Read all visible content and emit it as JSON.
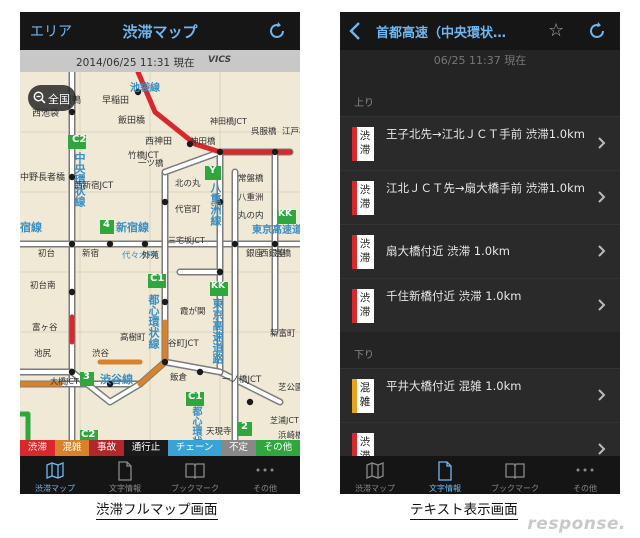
{
  "left_screen": {
    "nav": {
      "left_label": "エリア",
      "title": "渋滞マップ"
    },
    "status_bar": {
      "timestamp": "2014/06/25 11:31 現在",
      "vics": "VICS"
    },
    "zoom_button": {
      "label": "全国"
    },
    "map_labels": [
      "西巣鴨",
      "早稲田",
      "池袋線",
      "飯田橋",
      "西神田",
      "神田橋",
      "神田橋JCT",
      "呉服橋",
      "江戸橋",
      "西池袋",
      "竹橋JCT",
      "一ツ橋",
      "C2",
      "中央環状線",
      "中野長者橋",
      "北の丸",
      "常盤橋",
      "八重洲線",
      "八重洲",
      "丸の内",
      "東京高速道",
      "代官町",
      "西新宿JCT",
      "新宿線",
      "宿線",
      "初台",
      "新宿",
      "代々木PA",
      "外苑",
      "三宅坂JCT",
      "霞が関",
      "銀座",
      "京橋",
      "西銀座",
      "初台南",
      "都心環状線",
      "東京高速道路",
      "富ヶ谷",
      "高樹町",
      "谷町JCT",
      "新富町",
      "池尻",
      "渋谷",
      "渋谷線",
      "大橋JCT",
      "飯倉",
      "一ノ橋JCT",
      "都心環状線",
      "芝公園",
      "天現寺",
      "浜崎橋",
      "芝浦JCT",
      "Y",
      "KK",
      "KK",
      "C1",
      "C1",
      "4",
      "3",
      "C2",
      "2"
    ],
    "legend": [
      {
        "label": "渋滞",
        "color": "#d8282c"
      },
      {
        "label": "混雑",
        "color": "#d9822b"
      },
      {
        "label": "事故",
        "color": "#b0282c"
      },
      {
        "label": "通行止",
        "color": "#1a1a1a"
      },
      {
        "label": "チェーン",
        "color": "#3aa3d6"
      },
      {
        "label": "不定",
        "color": "#888888"
      },
      {
        "label": "その他",
        "color": "#2ea83d"
      }
    ],
    "tabs": [
      {
        "label": "渋滞マップ",
        "icon": "map-icon",
        "active": true
      },
      {
        "label": "文字情報",
        "icon": "document-icon",
        "active": false
      },
      {
        "label": "ブックマーク",
        "icon": "book-icon",
        "active": false
      },
      {
        "label": "その他",
        "icon": "more-icon",
        "active": false
      }
    ]
  },
  "right_screen": {
    "nav": {
      "title": "首都高速（中央環状…"
    },
    "timestamp": "06/25 11:37 現在",
    "sections": [
      {
        "header": "上り",
        "rows": [
          {
            "badge": "渋滞",
            "badge_color": "#d8282c",
            "text": "王子北先→江北ＪＣＴ手前 渋滞1.0km"
          },
          {
            "badge": "渋滞",
            "badge_color": "#d8282c",
            "text": "江北ＪＣＴ先→扇大橋手前 渋滞1.0km"
          },
          {
            "badge": "渋滞",
            "badge_color": "#d8282c",
            "text": "扇大橋付近 渋滞 1.0km"
          },
          {
            "badge": "渋滞",
            "badge_color": "#d8282c",
            "text": "千住新橋付近 渋滞 1.0km"
          }
        ]
      },
      {
        "header": "下り",
        "rows": [
          {
            "badge": "混雑",
            "badge_color": "#e8a21e",
            "text": "平井大橋付近 混雑 1.0km"
          },
          {
            "badge": "渋滞",
            "badge_color": "#d8282c",
            "text": ""
          }
        ]
      }
    ],
    "tabs": [
      {
        "label": "渋滞マップ",
        "icon": "map-icon",
        "active": false
      },
      {
        "label": "文字情報",
        "icon": "document-icon",
        "active": true
      },
      {
        "label": "ブックマーク",
        "icon": "book-icon",
        "active": false
      },
      {
        "label": "その他",
        "icon": "more-icon",
        "active": false
      }
    ]
  },
  "captions": {
    "left": "渋滞フルマップ画面",
    "right": "テキスト表示画面"
  },
  "watermark": "response."
}
